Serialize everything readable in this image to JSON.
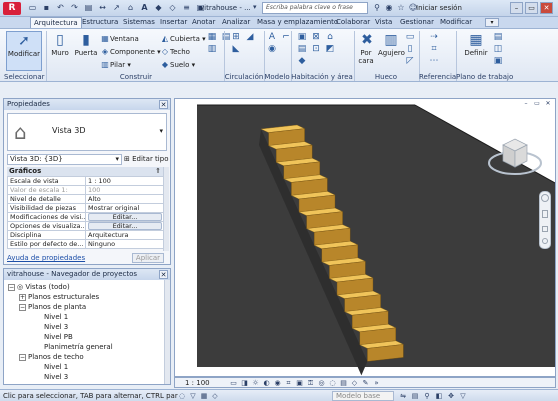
{
  "titlebar": {
    "logo": "R",
    "doc_title": "vitrahouse - ...",
    "search_placeholder": "Escriba palabra clave o frase",
    "signin": "Iniciar sesión",
    "window_controls": [
      "–",
      "▭",
      "✕"
    ]
  },
  "ribbon": {
    "tabs": [
      "Arquitectura",
      "Estructura",
      "Sistemas",
      "Insertar",
      "Anotar",
      "Analizar",
      "Masa y emplazamiento",
      "Colaborar",
      "Vista",
      "Gestionar",
      "Modificar"
    ],
    "active_tab": "Arquitectura",
    "tab_menu": "▾",
    "buttons": {
      "modificar": "Modificar",
      "muro": "Muro",
      "puerta": "Puerta",
      "ventana": "Ventana",
      "componente": "Componente",
      "pilar": "Pilar",
      "cubierta": "Cubierta",
      "techo": "Techo",
      "suelo": "Suelo",
      "por_cara": "Por cara",
      "agujero": "Agujero",
      "definir": "Definir"
    },
    "panels": [
      "Seleccionar",
      "Construir",
      "Circulación",
      "Modelo",
      "Habitación y área",
      "Hueco",
      "Referencia",
      "Plano de trabajo"
    ]
  },
  "properties": {
    "title": "Propiedades",
    "type_name": "Vista 3D",
    "view_selector": "Vista 3D: {3D}",
    "edit_type": "Editar tipo",
    "group": "Gráficos",
    "rows": [
      {
        "key": "Escala de vista",
        "value": "1 : 100"
      },
      {
        "key": "Valor de escala    1:",
        "value": "100"
      },
      {
        "key": "Nivel de detalle",
        "value": "Alto"
      },
      {
        "key": "Visibilidad de piezas",
        "value": "Mostrar original"
      },
      {
        "key": "Modificaciones de visi...",
        "value": "Editar..."
      },
      {
        "key": "Opciones de visualiza...",
        "value": "Editar..."
      },
      {
        "key": "Disciplina",
        "value": "Arquitectura"
      },
      {
        "key": "Estilo por defecto de...",
        "value": "Ninguno"
      }
    ],
    "help_link": "Ayuda de propiedades",
    "apply": "Aplicar"
  },
  "browser": {
    "title": "vitrahouse - Navegador de proyectos",
    "items": [
      {
        "label": "Vistas (todo)",
        "level": 0,
        "exp": "−"
      },
      {
        "label": "Planos estructurales",
        "level": 1,
        "exp": "+"
      },
      {
        "label": "Planos de planta",
        "level": 1,
        "exp": "−"
      },
      {
        "label": "Nivel 1",
        "level": 2,
        "exp": ""
      },
      {
        "label": "Nivel 3",
        "level": 2,
        "exp": ""
      },
      {
        "label": "Nivel PB",
        "level": 2,
        "exp": ""
      },
      {
        "label": "Planimetría general",
        "level": 2,
        "exp": ""
      },
      {
        "label": "Planos de techo",
        "level": 1,
        "exp": "−"
      },
      {
        "label": "Nivel 1",
        "level": 2,
        "exp": ""
      },
      {
        "label": "Nivel 3",
        "level": 2,
        "exp": ""
      }
    ]
  },
  "viewport": {
    "scale": "1 : 100",
    "view_cube": "view-cube-icon"
  },
  "statusbar": {
    "text": "Clic para seleccionar, TAB para alternar, CTRL par",
    "model": "Modelo base"
  },
  "colors": {
    "stair_top": "#f0c45a",
    "stair_front": "#b8862a",
    "stair_side": "#2e2e2e",
    "wall": "#3a3a3a",
    "accent": "#2e5e9e"
  }
}
